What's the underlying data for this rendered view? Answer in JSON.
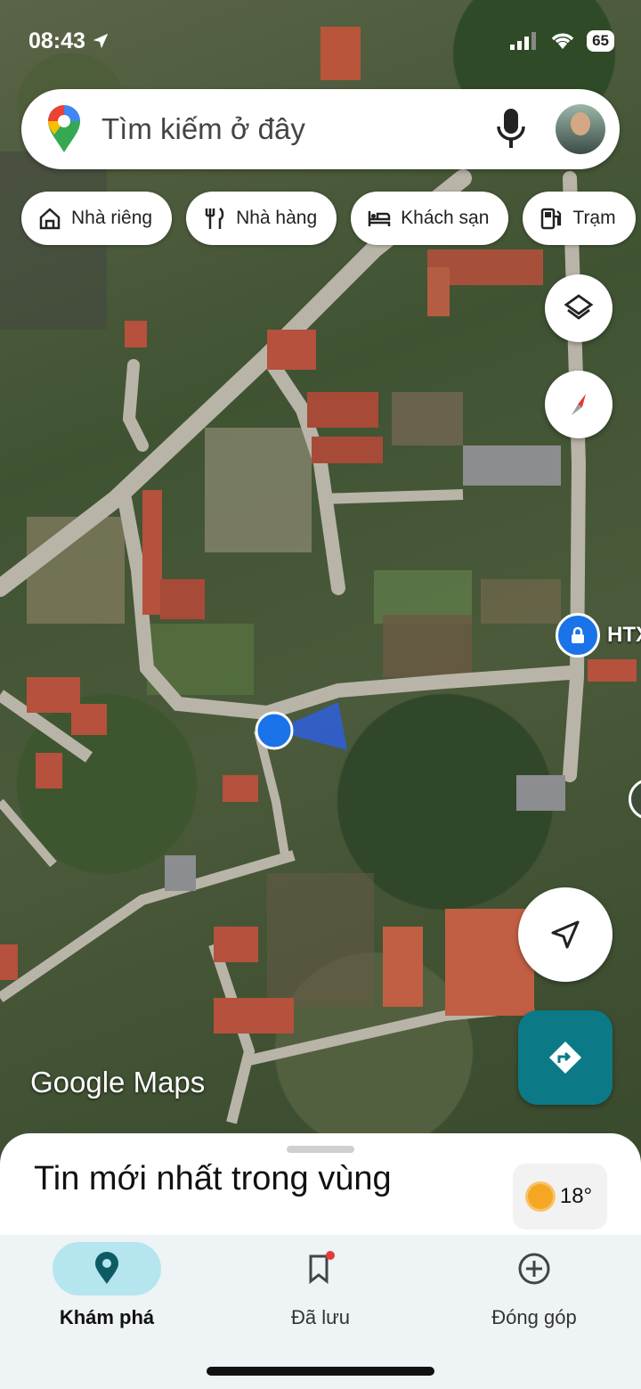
{
  "status_bar": {
    "time": "08:43",
    "battery": "65"
  },
  "search": {
    "placeholder": "Tìm kiếm ở đây"
  },
  "chips": [
    {
      "label": "Nhà riêng",
      "icon": "home-icon"
    },
    {
      "label": "Nhà hàng",
      "icon": "restaurant-icon"
    },
    {
      "label": "Khách sạn",
      "icon": "hotel-icon"
    },
    {
      "label": "Trạm",
      "icon": "gas-station-icon"
    }
  ],
  "map": {
    "watermark": "Google Maps",
    "poi_label": "HTX",
    "accent": "#0b7a86",
    "location_dot_color": "#1a73e8"
  },
  "sheet": {
    "title": "Tin mới nhất trong vùng",
    "weather_temp": "18°"
  },
  "bottom_nav": [
    {
      "label": "Khám phá",
      "icon": "explore-pin-icon"
    },
    {
      "label": "Đã lưu",
      "icon": "bookmark-icon"
    },
    {
      "label": "Đóng góp",
      "icon": "add-circle-icon"
    }
  ]
}
